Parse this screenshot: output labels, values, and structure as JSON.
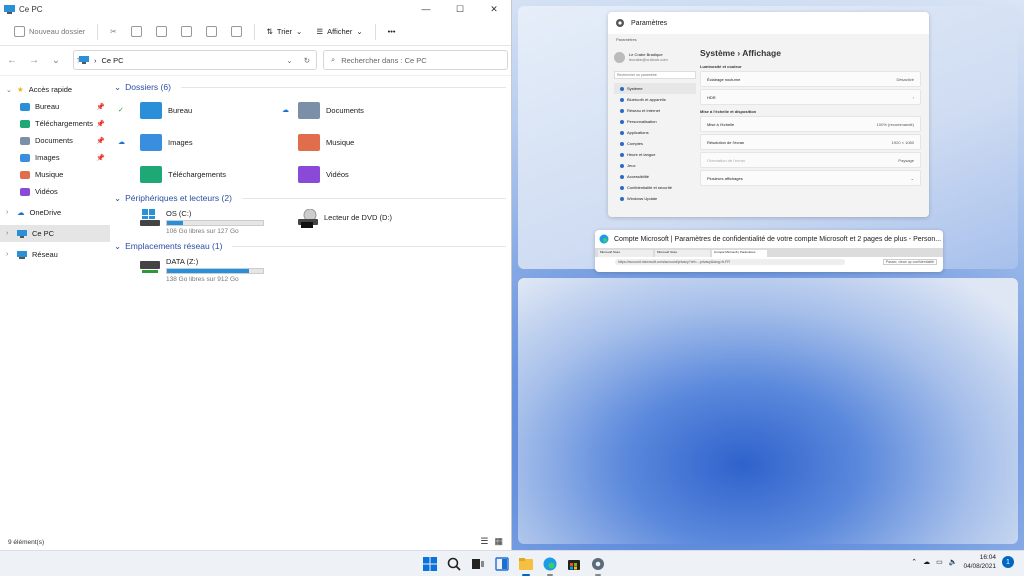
{
  "explorer": {
    "title": "Ce PC",
    "commands": {
      "new_folder": "Nouveau dossier",
      "sort": "Trier",
      "view": "Afficher",
      "more": "•••"
    },
    "address": {
      "path": "Ce PC"
    },
    "search": {
      "placeholder": "Rechercher dans : Ce PC"
    },
    "sidebar": [
      {
        "label": "Accès rapide",
        "icon": "star-icon"
      },
      {
        "label": "Bureau",
        "icon": "desktop-folder-icon",
        "pinned": true
      },
      {
        "label": "Téléchargements",
        "icon": "downloads-folder-icon",
        "pinned": true
      },
      {
        "label": "Documents",
        "icon": "documents-folder-icon",
        "pinned": true
      },
      {
        "label": "Images",
        "icon": "pictures-folder-icon",
        "pinned": true
      },
      {
        "label": "Musique",
        "icon": "music-folder-icon"
      },
      {
        "label": "Vidéos",
        "icon": "videos-folder-icon"
      },
      {
        "label": "OneDrive",
        "icon": "cloud-icon"
      },
      {
        "label": "Ce PC",
        "icon": "pc-icon"
      },
      {
        "label": "Réseau",
        "icon": "network-icon"
      }
    ],
    "folders_header": "Dossiers (6)",
    "folders": [
      {
        "label": "Bureau",
        "color": "#2a8fd8"
      },
      {
        "label": "Documents",
        "color": "#7b8fa8"
      },
      {
        "label": "Images",
        "color": "#3a8ee0"
      },
      {
        "label": "Musique",
        "color": "#e06d4c"
      },
      {
        "label": "Téléchargements",
        "color": "#1ea876"
      },
      {
        "label": "Vidéos",
        "color": "#8a4ad8"
      }
    ],
    "devices_header": "Périphériques et lecteurs (2)",
    "drives": [
      {
        "label": "OS (C:)",
        "sub": "106 Go libres sur 127 Go",
        "used_fraction": 0.17
      },
      {
        "label": "Lecteur de DVD (D:)",
        "badge": "DVD"
      }
    ],
    "network_header": "Emplacements réseau (1)",
    "network": [
      {
        "label": "DATA (Z:)",
        "sub": "138 Go libres sur 912 Go",
        "used_fraction": 0.85
      }
    ],
    "status": "9 élément(s)"
  },
  "settings": {
    "app_title": "Paramètres",
    "inner_title": "Paramètres",
    "user_name": "Le Crabe Bradique",
    "user_email": "lecrabe@outlook.com",
    "find_placeholder": "Rechercher un paramètre",
    "nav": [
      "Système",
      "Bluetooth et appareils",
      "Réseau et Internet",
      "Personnalisation",
      "Applications",
      "Comptes",
      "Heure et langue",
      "Jeux",
      "Accessibilité",
      "Confidentialité et sécurité",
      "Windows Update"
    ],
    "breadcrumb": "Système  ›  Affichage",
    "sec1": "Luminosité et couleur",
    "cards1": [
      {
        "label": "Éclairage nocturne",
        "right": "Désactivé"
      },
      {
        "label": "HDR",
        "right": "›"
      }
    ],
    "sec2": "Mise à l'échelle et disposition",
    "cards2": [
      {
        "label": "Mise à l'échelle",
        "right": "100% (recommandé)"
      },
      {
        "label": "Résolution de l'écran",
        "right": "1920 × 1080"
      },
      {
        "label": "Orientation de l'écran",
        "right": "Paysage"
      },
      {
        "label": "Plusieurs affichages",
        "right": "⌄"
      }
    ]
  },
  "edge": {
    "title": "Compte Microsoft | Paramètres de confidentialité de votre compte Microsoft et 2 pages de plus - Person...",
    "tabs": [
      "Microsoft Store",
      "Microsoft Store",
      "Compte Microsoft | Paramètres"
    ],
    "url": "https://account.microsoft.com/account/privacy?ref=...privacy&lang=fr-FR",
    "tab_button": "Passer, clean up confidentialité"
  },
  "taskbar": {
    "time": "16:04",
    "date": "04/08/2021",
    "notifications": "1"
  }
}
